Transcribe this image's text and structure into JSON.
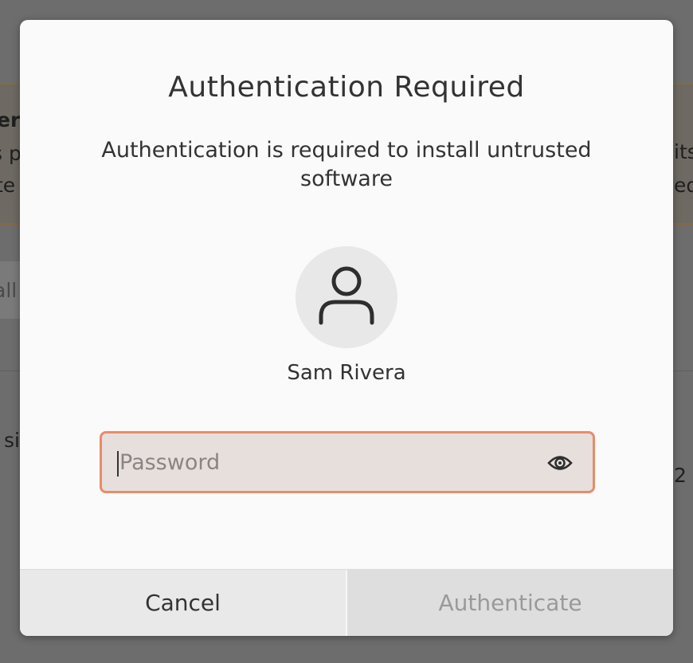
{
  "dialog": {
    "title": "Authentication Required",
    "message": "Authentication is required to install untrusted software",
    "user": {
      "name": "Sam Rivera",
      "avatar_icon": "user-silhouette-icon"
    },
    "password": {
      "placeholder": "Password",
      "value": "",
      "reveal_icon": "eye-icon"
    },
    "buttons": {
      "cancel": "Cancel",
      "authenticate": "Authenticate"
    },
    "accent_color": "#e88c6a"
  },
  "background": {
    "fragments": [
      "er",
      "s p",
      "te",
      "its",
      "ed",
      "all",
      "si",
      "2"
    ]
  }
}
